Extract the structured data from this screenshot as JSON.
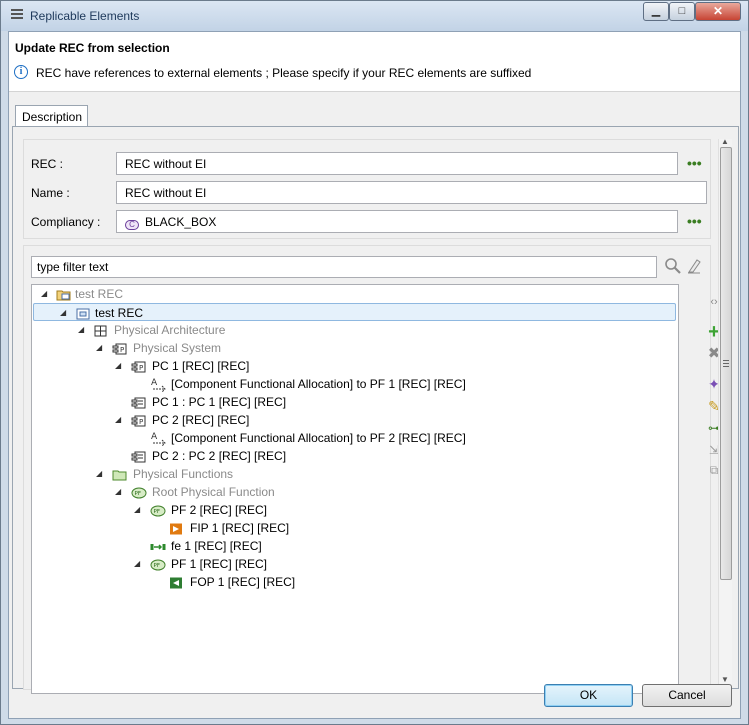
{
  "window": {
    "title": "Replicable Elements",
    "minimize": "▁",
    "maximize": "□",
    "close": "✕"
  },
  "header": {
    "title": "Update REC from selection",
    "info": "REC have references to external elements ; Please specify if your REC elements are suffixed",
    "info_icon": "info-icon"
  },
  "tabs": [
    {
      "label": "Description"
    }
  ],
  "form": {
    "rec_label": "REC :",
    "rec_value": "REC without EI",
    "rec_more": "•••",
    "name_label": "Name :",
    "name_value": "REC without EI",
    "compliancy_label": "Compliancy :",
    "compliancy_icon_letter": "C",
    "compliancy_value": "BLACK_BOX",
    "compliancy_more": "•••"
  },
  "filter": {
    "placeholder": "type filter text"
  },
  "tree": [
    {
      "label": "test REC",
      "muted": true,
      "icon": "folder-rec-icon",
      "expanded": true
    },
    {
      "label": "test REC",
      "selected": true,
      "icon": "rec-icon",
      "expanded": true
    },
    {
      "label": "Physical Architecture",
      "muted": true,
      "icon": "architecture-icon",
      "expanded": true
    },
    {
      "label": "Physical System",
      "muted": true,
      "icon": "component-icon",
      "expanded": true
    },
    {
      "label": "PC 1 [REC] [REC]",
      "icon": "component-icon",
      "expanded": true
    },
    {
      "label": "[Component Functional Allocation] to PF 1 [REC] [REC]",
      "icon": "allocation-icon"
    },
    {
      "label": "PC 1 : PC 1 [REC] [REC]",
      "icon": "part-icon"
    },
    {
      "label": "PC 2 [REC] [REC]",
      "icon": "component-icon",
      "expanded": true
    },
    {
      "label": "[Component Functional Allocation] to PF 2 [REC] [REC]",
      "icon": "allocation-icon"
    },
    {
      "label": "PC 2 : PC 2 [REC] [REC]",
      "icon": "part-icon"
    },
    {
      "label": "Physical Functions",
      "muted": true,
      "icon": "folder-icon",
      "expanded": true
    },
    {
      "label": "Root Physical Function",
      "muted": true,
      "icon": "function-icon",
      "expanded": true
    },
    {
      "label": "PF 2 [REC] [REC]",
      "icon": "function-icon",
      "expanded": true
    },
    {
      "label": "FIP 1 [REC] [REC]",
      "icon": "input-port-icon"
    },
    {
      "label": "fe 1 [REC] [REC]",
      "icon": "exchange-icon"
    },
    {
      "label": "PF 1 [REC] [REC]",
      "icon": "function-icon",
      "expanded": true
    },
    {
      "label": "FOP 1 [REC] [REC]",
      "icon": "output-port-icon"
    }
  ],
  "buttons": {
    "ok": "OK",
    "cancel": "Cancel"
  },
  "colors": {
    "accent": "#3c7fb1",
    "tree_selection": "#e5f1fb",
    "more_dots": "#3a7d22"
  }
}
